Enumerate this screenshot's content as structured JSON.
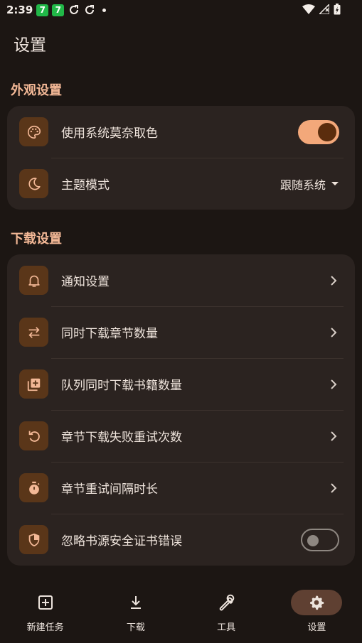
{
  "status_bar": {
    "time": "2:39",
    "badge1": "7",
    "badge2": "7"
  },
  "page_title": "设置",
  "appearance": {
    "title": "外观设置",
    "items": [
      {
        "label": "使用系统莫奈取色",
        "icon": "palette-icon",
        "control": "switch",
        "on": true
      },
      {
        "label": "主题模式",
        "icon": "moon-icon",
        "control": "dropdown",
        "value": "跟随系统"
      }
    ]
  },
  "download": {
    "title": "下载设置",
    "items": [
      {
        "label": "通知设置",
        "icon": "bell-icon",
        "control": "chevron"
      },
      {
        "label": "同时下载章节数量",
        "icon": "swap-icon",
        "control": "chevron"
      },
      {
        "label": "队列同时下载书籍数量",
        "icon": "library-add-icon",
        "control": "chevron"
      },
      {
        "label": "章节下载失败重试次数",
        "icon": "retry-icon",
        "control": "chevron"
      },
      {
        "label": "章节重试间隔时长",
        "icon": "timer-icon",
        "control": "chevron"
      },
      {
        "label": "忽略书源安全证书错误",
        "icon": "shield-icon",
        "control": "switch",
        "on": false
      }
    ]
  },
  "nav": {
    "items": [
      {
        "label": "新建任务",
        "icon": "add-box-icon",
        "active": false
      },
      {
        "label": "下载",
        "icon": "download-icon",
        "active": false
      },
      {
        "label": "工具",
        "icon": "wrench-icon",
        "active": false
      },
      {
        "label": "设置",
        "icon": "gear-icon",
        "active": true
      }
    ]
  },
  "colors": {
    "accent": "#f3a87a",
    "section_title": "#f3b896",
    "background": "#1c1613",
    "card": "#2b2320",
    "icon_tile": "#5a3619"
  }
}
